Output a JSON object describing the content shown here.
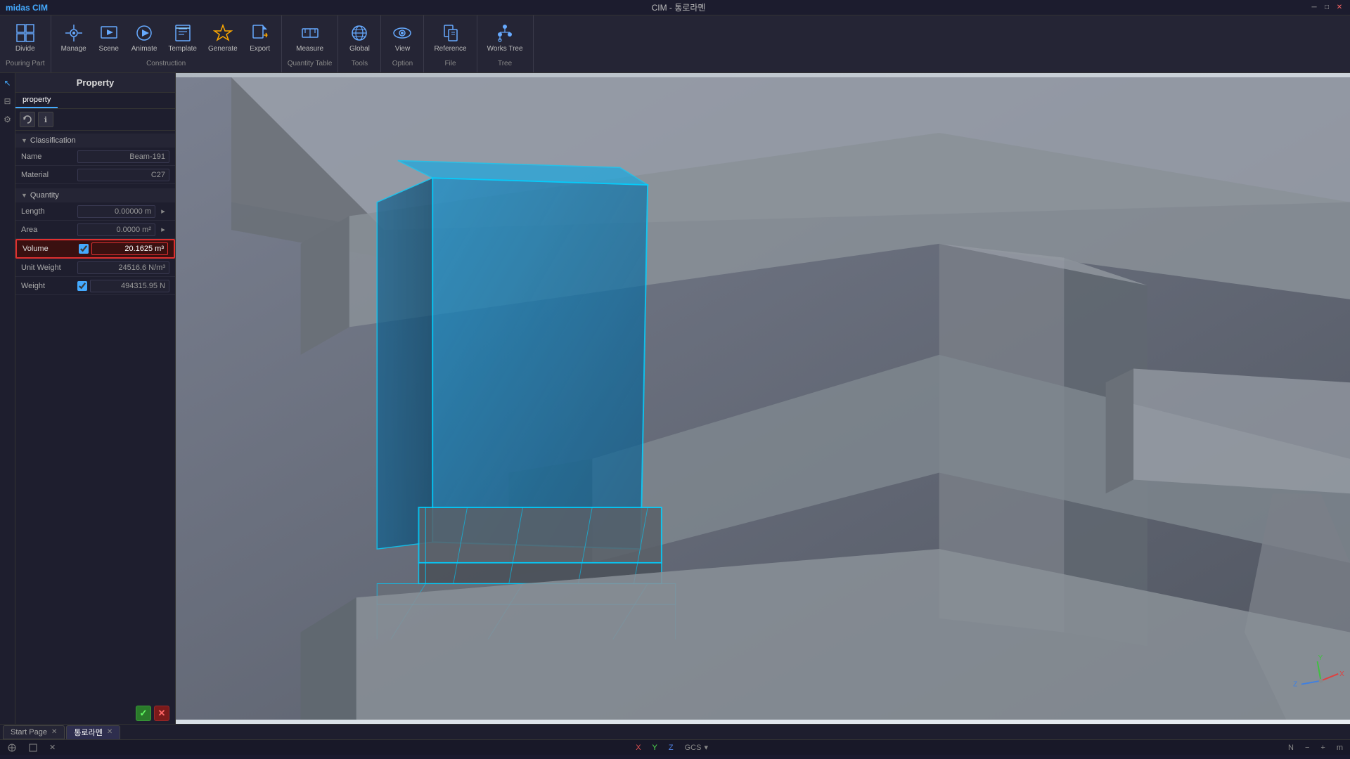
{
  "titlebar": {
    "app_name": "midas CIM",
    "window_title": "CIM - 통로라멘",
    "controls": [
      "minimize",
      "restore",
      "close"
    ]
  },
  "toolbar": {
    "groups": [
      {
        "label": "Pouring Part",
        "items": [
          {
            "id": "divide",
            "label": "Divide",
            "icon": "⊞"
          }
        ]
      },
      {
        "label": "Construction",
        "items": [
          {
            "id": "manage",
            "label": "Manage",
            "icon": "⚙"
          },
          {
            "id": "scene",
            "label": "Scene",
            "icon": "🎬"
          },
          {
            "id": "animate",
            "label": "Animate",
            "icon": "▶"
          },
          {
            "id": "template",
            "label": "Template",
            "icon": "📋"
          },
          {
            "id": "generate",
            "label": "Generate",
            "icon": "⚡"
          },
          {
            "id": "export",
            "label": "Export",
            "icon": "📤"
          }
        ]
      },
      {
        "label": "Quantity Table",
        "items": [
          {
            "id": "measure",
            "label": "Measure",
            "icon": "📏"
          }
        ]
      },
      {
        "label": "Tools",
        "items": [
          {
            "id": "global",
            "label": "Global",
            "icon": "🌐"
          }
        ]
      },
      {
        "label": "Option",
        "items": [
          {
            "id": "view",
            "label": "View",
            "icon": "👁"
          }
        ]
      },
      {
        "label": "File",
        "items": [
          {
            "id": "reference",
            "label": "Reference",
            "icon": "📎"
          }
        ]
      },
      {
        "label": "Tree",
        "items": [
          {
            "id": "works-tree",
            "label": "Works Tree",
            "icon": "🌲"
          }
        ]
      }
    ]
  },
  "property_panel": {
    "title": "Property",
    "tab": "property",
    "classification": {
      "label": "Classification",
      "name_label": "Name",
      "name_value": "Beam-191",
      "material_label": "Material",
      "material_value": "C27"
    },
    "quantity": {
      "label": "Quantity",
      "fields": [
        {
          "id": "length",
          "label": "Length",
          "value": "0.00000 m",
          "has_btn": true,
          "checked": false
        },
        {
          "id": "area",
          "label": "Area",
          "value": "0.0000 m²",
          "has_btn": true,
          "checked": false
        },
        {
          "id": "volume",
          "label": "Volume",
          "value": "20.1625 m³",
          "has_btn": false,
          "checked": true,
          "highlighted": true
        },
        {
          "id": "unit_weight",
          "label": "Unit Weight",
          "value": "24516.6 N/m³",
          "has_btn": false,
          "checked": false
        },
        {
          "id": "weight",
          "label": "Weight",
          "value": "494315.95 N",
          "has_btn": false,
          "checked": true
        }
      ]
    },
    "confirm_label": "✓",
    "cancel_label": "✕"
  },
  "tabs": [
    {
      "id": "start",
      "label": "Start Page",
      "closeable": true
    },
    {
      "id": "main",
      "label": "통로라멘",
      "closeable": true,
      "active": true
    }
  ],
  "statusbar": {
    "x_label": "X",
    "y_label": "Y",
    "z_label": "Z",
    "gcs_label": "GCS",
    "n_label": "N"
  }
}
